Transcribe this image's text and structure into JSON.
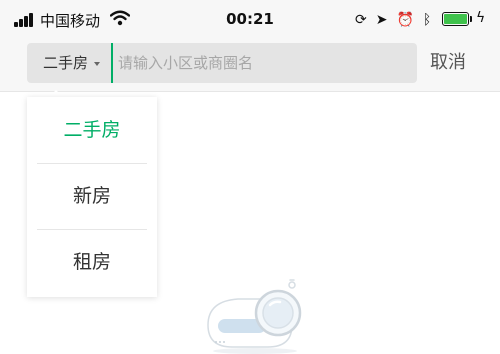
{
  "status_bar": {
    "carrier": "中国移动",
    "time": "00:21",
    "icons": [
      "signal-icon",
      "wifi-icon",
      "screen-lock-icon",
      "location-icon",
      "alarm-icon",
      "bluetooth-icon",
      "battery-icon",
      "charging-icon"
    ],
    "battery_color": "#3fc24c"
  },
  "search": {
    "type_label": "二手房",
    "placeholder": "请输入小区或商圈名",
    "cancel_label": "取消",
    "accent_color": "#00ae66"
  },
  "dropdown": {
    "items": [
      {
        "label": "二手房",
        "active": true
      },
      {
        "label": "新房",
        "active": false
      },
      {
        "label": "租房",
        "active": false
      }
    ]
  },
  "empty_state": {
    "icon": "search-empty-illustration"
  }
}
